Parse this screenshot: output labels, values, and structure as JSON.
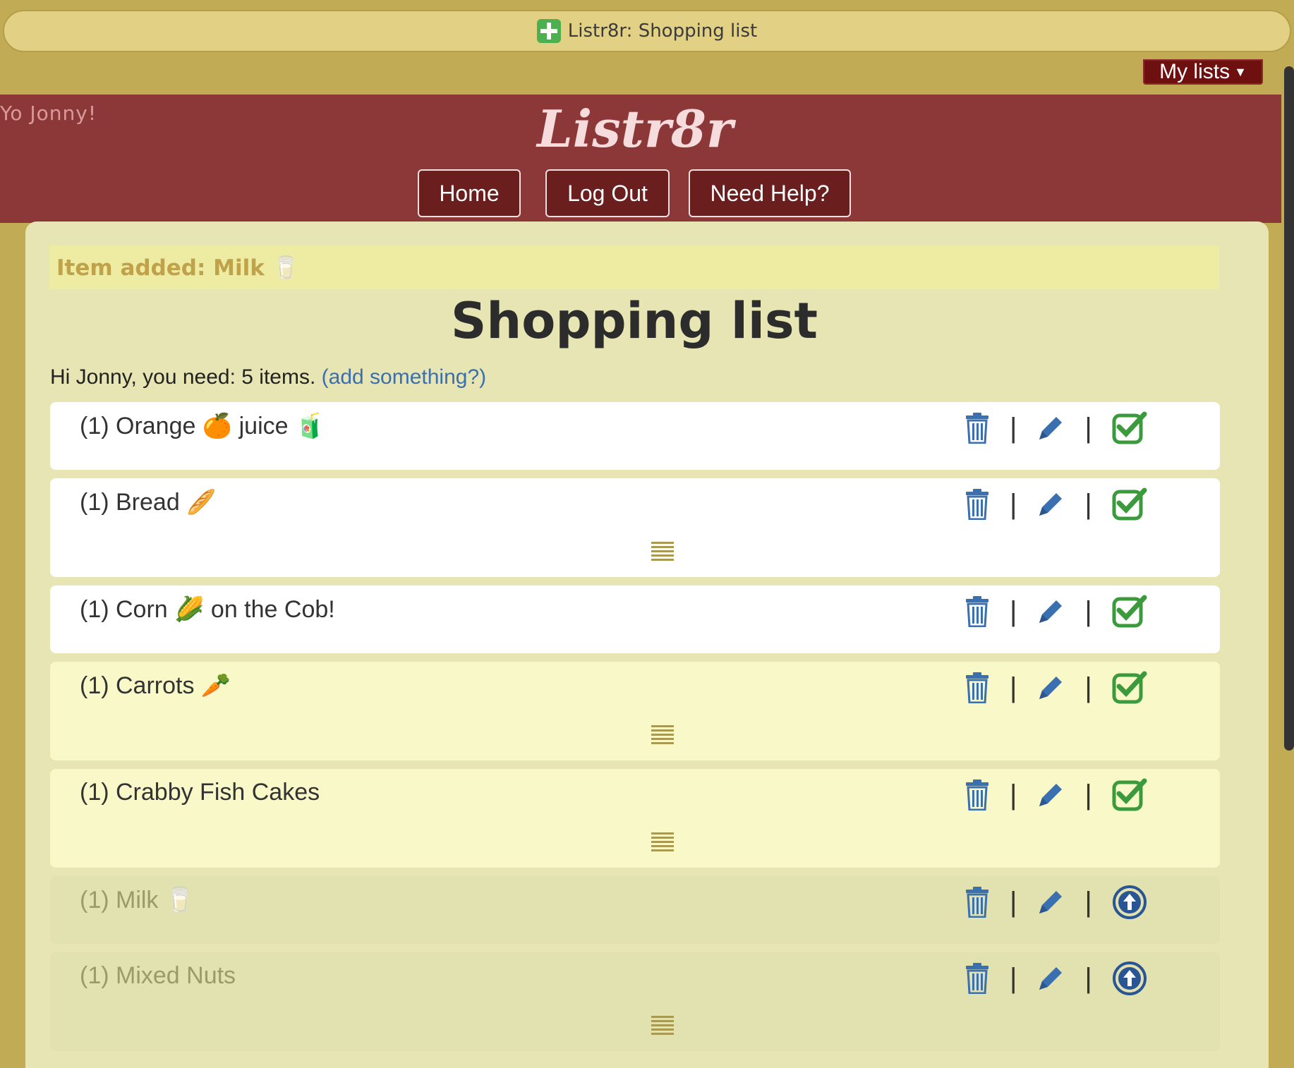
{
  "window": {
    "title": "Listr8r: Shopping list"
  },
  "topbar": {
    "mylists_label": "My lists"
  },
  "header": {
    "greeting": "Yo Jonny!",
    "logo": "Listr8r",
    "nav": [
      {
        "label": "Home"
      },
      {
        "label": "Log Out"
      },
      {
        "label": "Need Help?"
      }
    ]
  },
  "flash": {
    "message": "Item added: Milk 🥛"
  },
  "page": {
    "title": "Shopping list",
    "summary_text": "Hi Jonny, you need: 5 items.",
    "add_link": "(add something?)"
  },
  "items": [
    {
      "label": "(1) Orange 🍊 juice 🧃",
      "status": "todo"
    },
    {
      "label": "(1) Bread 🥖",
      "status": "todo"
    },
    {
      "label": "(1) Corn 🌽 on the Cob!",
      "status": "todo"
    },
    {
      "label": "(1) Carrots 🥕",
      "status": "todo"
    },
    {
      "label": "(1) Crabby Fish Cakes",
      "status": "todo"
    },
    {
      "label": "(1) Milk 🥛",
      "status": "done"
    },
    {
      "label": "(1) Mixed Nuts",
      "status": "done"
    }
  ],
  "icons": {
    "delete": "trash-icon",
    "edit": "pencil-icon",
    "complete": "check-square-icon",
    "restore": "arrow-up-circle-icon",
    "drag": "drag-handle-icon"
  },
  "colors": {
    "background": "#c2ab55",
    "header": "#8c3838",
    "main": "#e6e5b3",
    "action_blue": "#3a6fb0",
    "check_green": "#3b9a3b"
  },
  "separator": "|"
}
